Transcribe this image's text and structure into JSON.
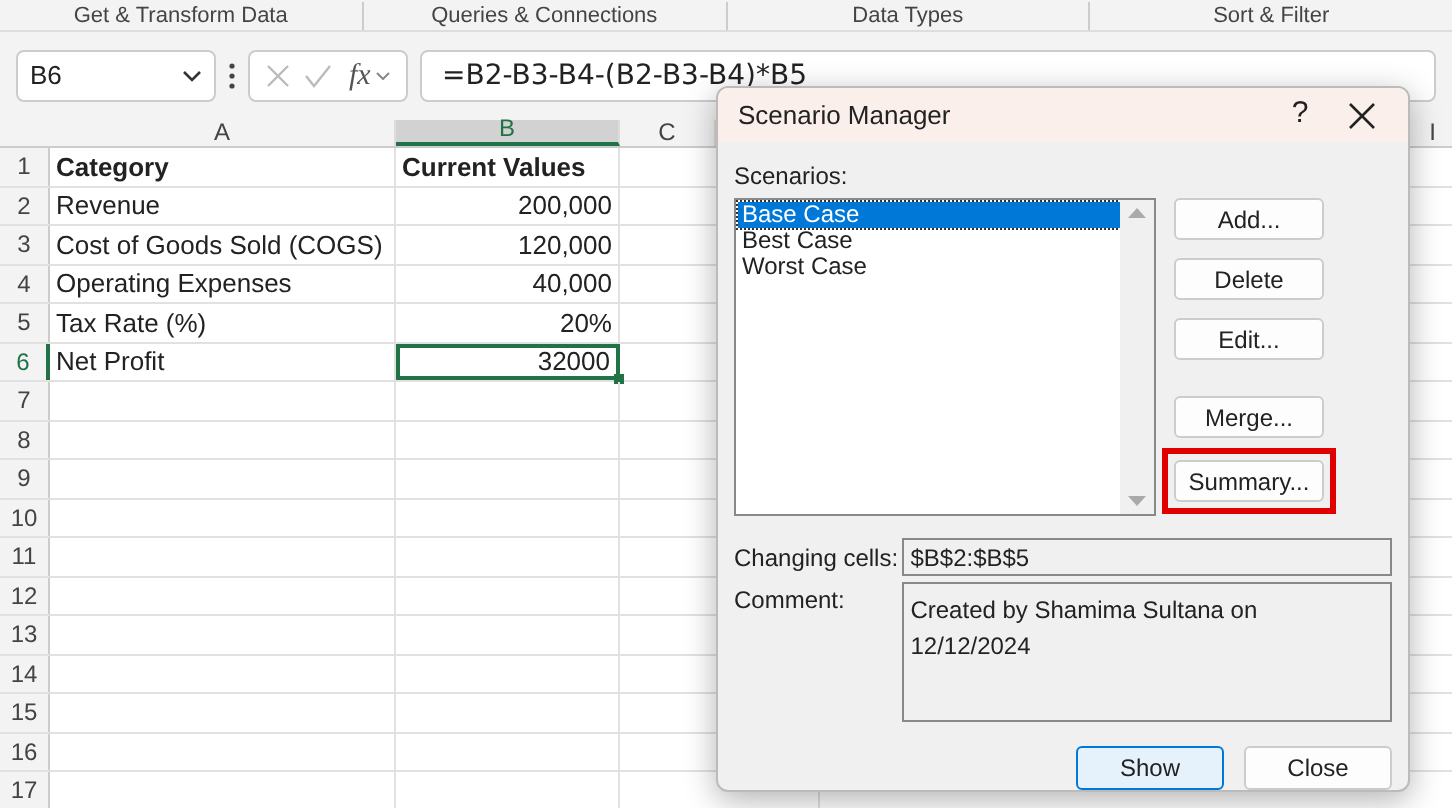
{
  "ribbon_groups": [
    "Get & Transform Data",
    "Queries & Connections",
    "Data Types",
    "Sort & Filter"
  ],
  "name_box": {
    "value": "B6"
  },
  "function_symbol": "fx",
  "formula_bar": {
    "value": "=B2-B3-B4-(B2-B3-B4)*B5"
  },
  "columns": [
    {
      "label": "A",
      "selected": false
    },
    {
      "label": "B",
      "selected": true
    },
    {
      "label": "C",
      "selected": false
    }
  ],
  "far_column": {
    "label": "I"
  },
  "header_row": {
    "label": "1",
    "cells": [
      "Category",
      "Current Values"
    ]
  },
  "rows": [
    {
      "label": "2",
      "cells": [
        "Revenue",
        "200,000"
      ],
      "selected": false
    },
    {
      "label": "3",
      "cells": [
        "Cost of Goods Sold (COGS)",
        "120,000"
      ],
      "selected": false
    },
    {
      "label": "4",
      "cells": [
        "Operating Expenses",
        "40,000"
      ],
      "selected": false
    },
    {
      "label": "5",
      "cells": [
        "Tax Rate (%)",
        "20%"
      ],
      "selected": false
    },
    {
      "label": "6",
      "cells": [
        "Net Profit",
        "32000"
      ],
      "selected": true
    },
    {
      "label": "7",
      "cells": [],
      "selected": false
    },
    {
      "label": "8",
      "cells": [],
      "selected": false
    },
    {
      "label": "9",
      "cells": [],
      "selected": false
    },
    {
      "label": "10",
      "cells": [],
      "selected": false
    },
    {
      "label": "11",
      "cells": [],
      "selected": false
    },
    {
      "label": "12",
      "cells": [],
      "selected": false
    },
    {
      "label": "13",
      "cells": [],
      "selected": false
    },
    {
      "label": "14",
      "cells": [],
      "selected": false
    },
    {
      "label": "15",
      "cells": [],
      "selected": false
    },
    {
      "label": "16",
      "cells": [],
      "selected": false
    },
    {
      "label": "17",
      "cells": [],
      "selected": false
    }
  ],
  "dialog": {
    "title": "Scenario Manager",
    "help": "?",
    "scenarios_label": "Scenarios:",
    "scenarios": [
      {
        "label": "Base Case",
        "selected": true
      },
      {
        "label": "Best Case",
        "selected": false
      },
      {
        "label": "Worst Case",
        "selected": false
      }
    ],
    "side_buttons": [
      {
        "label": "Add...",
        "highlighted": false,
        "gap_before": false
      },
      {
        "label": "Delete",
        "highlighted": false,
        "gap_before": false
      },
      {
        "label": "Edit...",
        "highlighted": false,
        "gap_before": false
      },
      {
        "label": "Merge...",
        "highlighted": false,
        "gap_before": true
      },
      {
        "label": "Summary...",
        "highlighted": true,
        "gap_before": false
      }
    ],
    "changing_cells": {
      "label": "Changing cells:",
      "value": "$B$2:$B$5"
    },
    "comment": {
      "label": "Comment:",
      "value": "Created by Shamima Sultana on 12/12/2024"
    },
    "footer_buttons": [
      {
        "label": "Show",
        "default": true
      },
      {
        "label": "Close",
        "default": false
      }
    ]
  }
}
